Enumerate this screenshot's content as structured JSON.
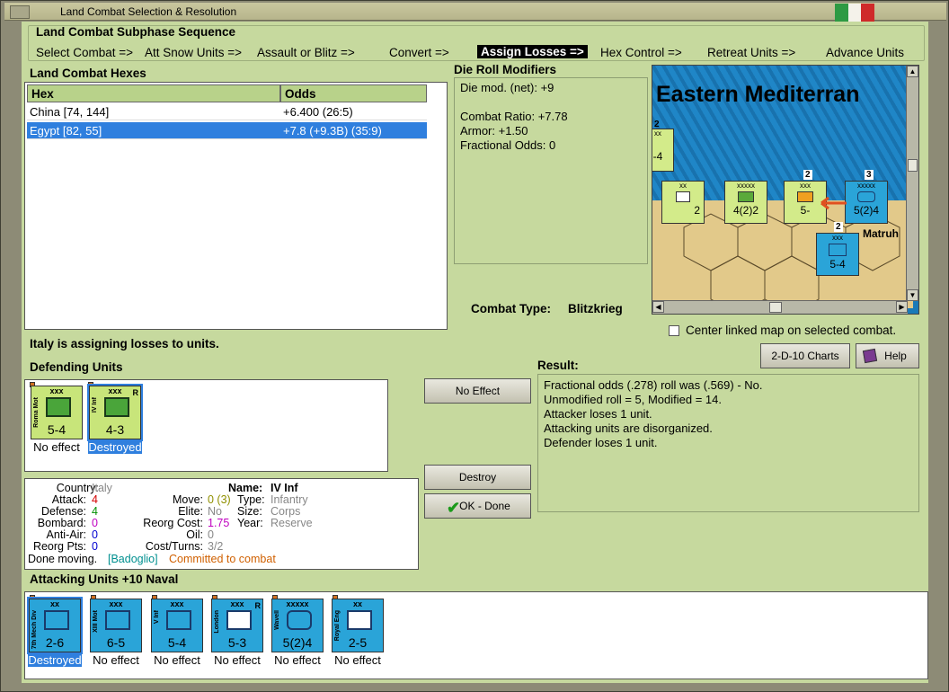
{
  "window": {
    "title": "Land Combat Selection & Resolution"
  },
  "subphase": {
    "heading": "Land Combat Subphase Sequence",
    "steps": [
      "Select Combat =>",
      "Att Snow Units =>",
      "Assault or Blitz =>",
      "Convert =>",
      "Assign Losses =>",
      "Hex Control =>",
      "Retreat Units =>",
      "Advance Units"
    ],
    "active_index": 4
  },
  "hexes": {
    "heading": "Land Combat Hexes",
    "columns": [
      "Hex",
      "Odds"
    ],
    "rows": [
      {
        "hex": "China [74, 144]",
        "odds": "+6.400 (26:5)"
      },
      {
        "hex": "Egypt [82, 55]",
        "odds": "+7.8 (+9.3B) (35:9)"
      }
    ],
    "selected_index": 1
  },
  "modifiers": {
    "heading": "Die Roll Modifiers",
    "lines": [
      "Die mod. (net): +9",
      "",
      "Combat Ratio: +7.78",
      "Armor: +1.50",
      "Fractional Odds: 0"
    ]
  },
  "map": {
    "title": "Eastern Mediterran",
    "place": "Matruh",
    "units": [
      {
        "size": "xx",
        "value": "2"
      },
      {
        "size": "xxxxx",
        "value": "4(2)2"
      },
      {
        "size": "xxx",
        "value": "5-"
      },
      {
        "size": "xxxxx",
        "value": "5(2)4"
      },
      {
        "size": "xxx",
        "value": "5-4"
      },
      {
        "size": "xx",
        "value": "-4"
      }
    ],
    "stack_counts": [
      "2",
      "2",
      "3",
      "2"
    ]
  },
  "combat_type": {
    "label": "Combat Type:",
    "value": "Blitzkrieg"
  },
  "center_map": {
    "label": "Center linked map on selected combat.",
    "checked": false
  },
  "buttons": {
    "charts": "2-D-10 Charts",
    "help": "Help",
    "no_effect": "No Effect",
    "destroy": "Destroy",
    "ok_done": "OK - Done"
  },
  "status": "Italy is assigning losses to units.",
  "defending": {
    "heading": "Defending Units",
    "units": [
      {
        "name": "Roma Mot",
        "size": "xxx",
        "value": "5-4",
        "caption": "No effect",
        "r": "",
        "selected": false
      },
      {
        "name": "IV Inf",
        "size": "xxx",
        "value": "4-3",
        "caption": "Destroyed",
        "r": "R",
        "selected": true
      }
    ]
  },
  "result": {
    "heading": "Result:",
    "lines": [
      "Fractional odds (.278) roll was (.569)  - No.",
      "Unmodified roll = 5, Modified = 14.",
      "Attacker loses 1 unit.",
      "Attacking units are disorganized.",
      "Defender loses 1 unit."
    ]
  },
  "info": {
    "country_label": "Country:",
    "country": "Italy",
    "attack_label": "Attack:",
    "attack": "4",
    "defense_label": "Defense:",
    "defense": "4",
    "bombard_label": "Bombard:",
    "bombard": "0",
    "antiair_label": "Anti-Air:",
    "antiair": "0",
    "reorg_label": "Reorg Pts:",
    "reorg": "0",
    "name_label": "Name:",
    "name": "IV Inf",
    "move_label": "Move:",
    "move": "0 (3)",
    "type_label": "Type:",
    "type": "Infantry",
    "elite_label": "Elite:",
    "elite": "No",
    "size_label": "Size:",
    "size": "Corps",
    "reorg_cost_label": "Reorg Cost:",
    "reorg_cost": "1.75",
    "year_label": "Year:",
    "year": "Reserve",
    "oil_label": "Oil:",
    "oil": "0",
    "cost_label": "Cost/Turns:",
    "cost": "3/2",
    "done": "Done moving.",
    "leader": "[Badoglio]",
    "committed": "Committed to combat"
  },
  "attacking": {
    "heading": "Attacking Units +10 Naval",
    "units": [
      {
        "name": "7th Mech Div",
        "size": "xx",
        "value": "2-6",
        "caption": "Destroyed",
        "r": "",
        "selected": true
      },
      {
        "name": "XIII Mot",
        "size": "xxx",
        "value": "6-5",
        "caption": "No effect",
        "r": "",
        "selected": false
      },
      {
        "name": "V Inf",
        "size": "xxx",
        "value": "5-4",
        "caption": "No effect",
        "r": "",
        "selected": false
      },
      {
        "name": "London",
        "size": "xxx",
        "value": "5-3",
        "caption": "No effect",
        "r": "R",
        "selected": false
      },
      {
        "name": "Wavell",
        "size": "xxxxx",
        "value": "5(2)4",
        "caption": "No effect",
        "r": "",
        "selected": false
      },
      {
        "name": "Royal Eng",
        "size": "xx",
        "value": "2-5",
        "caption": "No effect",
        "r": "",
        "selected": false
      }
    ]
  },
  "colors": {
    "panel": "#c6d99e",
    "allied": "#2aa4d8",
    "axis": "#c8e57a",
    "selected": "#2f7fde",
    "attack": "#d40000",
    "defense": "#009000",
    "bombard": "#c000c0",
    "antiair": "#0000d0",
    "committed": "#d06000",
    "leader": "#009090"
  }
}
